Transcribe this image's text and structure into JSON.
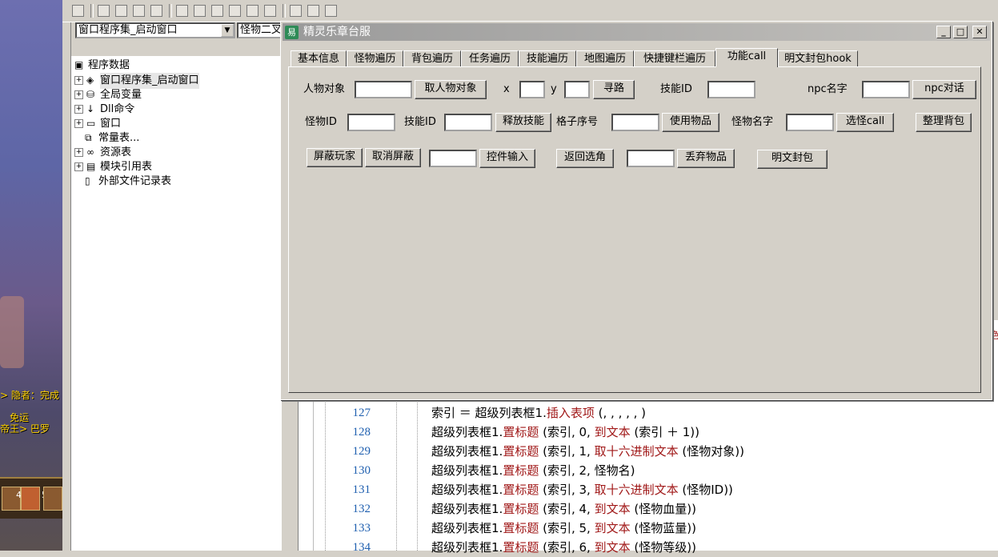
{
  "game": {
    "text1": "> 隐者：完成",
    "text2": "免运",
    "text3": "帝王> 巴罗",
    "bar_nums": [
      "4",
      "5"
    ]
  },
  "ide": {
    "combo1": "窗口程序集_启动窗口",
    "combo2": "怪物二叉"
  },
  "tree": {
    "root": "程序数据",
    "items": [
      {
        "label": "窗口程序集_启动窗口",
        "icon": "layers-icon"
      },
      {
        "label": "全局变量",
        "icon": "database-icon"
      },
      {
        "label": "Dll命令",
        "icon": "dll-icon"
      },
      {
        "label": "窗口",
        "icon": "window-icon"
      },
      {
        "label": "常量表...",
        "icon": "constants-icon"
      },
      {
        "label": "资源表",
        "icon": "resources-icon"
      },
      {
        "label": "模块引用表",
        "icon": "module-icon"
      },
      {
        "label": "外部文件记录表",
        "icon": "file-icon"
      }
    ]
  },
  "code": {
    "lines": [
      {
        "n": "127",
        "a": "索引 ＝ 超级列表框1.",
        "k": "插入表项",
        "b": " (, , , , , )"
      },
      {
        "n": "128",
        "a": "超级列表框1.",
        "k": "置标题",
        "b": " (索引, 0, ",
        "k2": "到文本",
        "c": " (索引 ＋ 1))"
      },
      {
        "n": "129",
        "a": "超级列表框1.",
        "k": "置标题",
        "b": " (索引, 1, ",
        "k2": "取十六进制文本",
        "c": " (怪物对象))"
      },
      {
        "n": "130",
        "a": "超级列表框1.",
        "k": "置标题",
        "b": " (索引, 2, 怪物名)"
      },
      {
        "n": "131",
        "a": "超级列表框1.",
        "k": "置标题",
        "b": " (索引, 3, ",
        "k2": "取十六进制文本",
        "c": " (怪物ID))"
      },
      {
        "n": "132",
        "a": "超级列表框1.",
        "k": "置标题",
        "b": " (索引, 4, ",
        "k2": "到文本",
        "c": " (怪物血量))"
      },
      {
        "n": "133",
        "a": "超级列表框1.",
        "k": "置标题",
        "b": " (索引, 5, ",
        "k2": "到文本",
        "c": " (怪物蓝量))"
      },
      {
        "n": "134",
        "a": "超级列表框1.",
        "k": "置标题",
        "b": " (索引, 6, ",
        "k2": "到文本",
        "c": " (怪物等级))"
      }
    ],
    "edge_text": "绝"
  },
  "dialog": {
    "title": "精灵乐章台服",
    "min": "_",
    "max": "□",
    "close": "✕",
    "tabs": [
      "基本信息",
      "怪物遍历",
      "背包遍历",
      "任务遍历",
      "技能遍历",
      "地图遍历",
      "快捷键栏遍历",
      "功能call",
      "明文封包hook"
    ],
    "row1": {
      "char_label": "人物对象",
      "get_char_btn": "取人物对象",
      "x_label": "x",
      "y_label": "y",
      "pathfind_btn": "寻路",
      "skill_label": "技能ID",
      "npc_label": "npc名字",
      "npc_btn": "npc对话"
    },
    "row2": {
      "monster_label": "怪物ID",
      "skill_label": "技能ID",
      "cast_btn": "释放技能",
      "slot_label": "格子序号",
      "use_btn": "使用物品",
      "monster_name_label": "怪物名字",
      "select_btn": "选怪call",
      "sort_btn": "整理背包"
    },
    "row3": {
      "block_btn": "屏蔽玩家",
      "unblock_btn": "取消屏蔽",
      "control_btn": "控件输入",
      "back_btn": "返回选角",
      "drop_btn": "丢弃物品",
      "packet_btn": "明文封包"
    }
  }
}
